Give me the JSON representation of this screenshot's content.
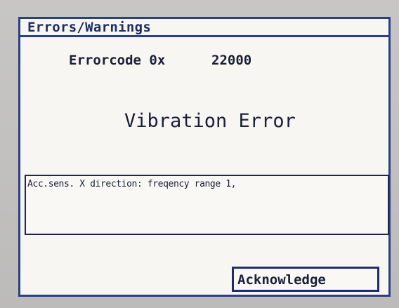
{
  "window": {
    "title": "Errors/Warnings"
  },
  "error": {
    "code_label": "Errorcode 0x",
    "code_value": "22000",
    "title": "Vibration Error",
    "message": "Acc.sens. X direction: freqency range 1,"
  },
  "actions": {
    "acknowledge_label": "Acknowledge"
  },
  "colors": {
    "frame": "#2b3f86",
    "text": "#1b1f38",
    "background": "#f7f6f2"
  }
}
